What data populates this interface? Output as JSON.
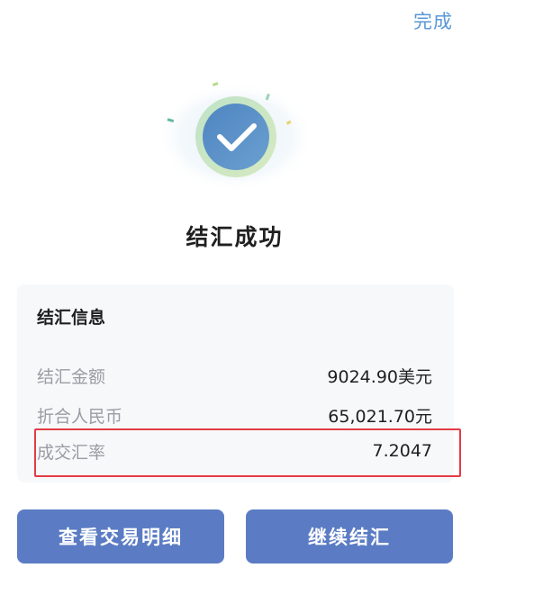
{
  "header": {
    "done_label": "完成"
  },
  "status": {
    "title": "结汇成功"
  },
  "info": {
    "title": "结汇信息",
    "rows": [
      {
        "label": "结汇金额",
        "value": "9024.90美元"
      },
      {
        "label": "折合人民币",
        "value": "65,021.70元"
      },
      {
        "label": "成交汇率",
        "value": "7.2047"
      }
    ]
  },
  "actions": {
    "view_detail_label": "查看交易明细",
    "continue_label": "继续结汇"
  },
  "colors": {
    "primary_button": "#5b7cc4",
    "link": "#5a97d6",
    "highlight_border": "#e43b43",
    "check_circle": "#5a8fc6"
  },
  "icons": {
    "success": "check-circle-icon"
  }
}
